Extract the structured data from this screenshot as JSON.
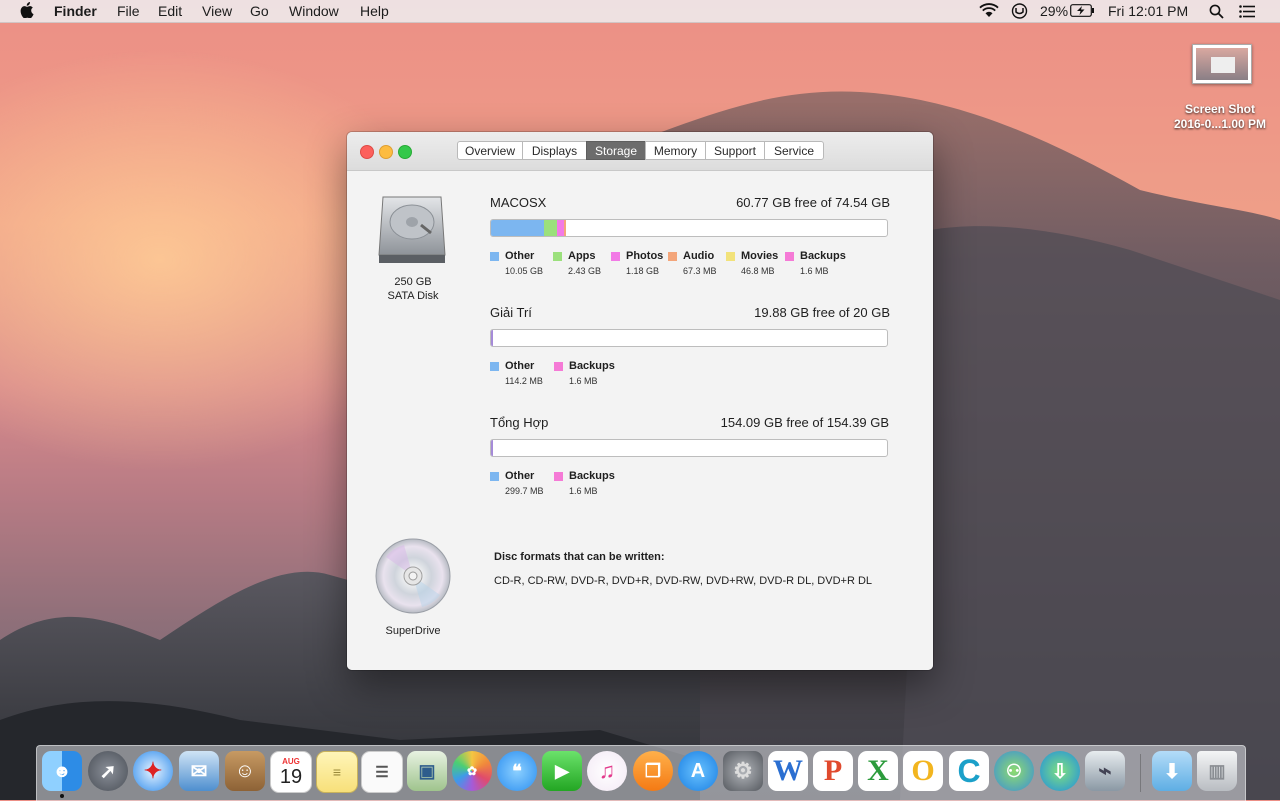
{
  "menubar": {
    "app_name": "Finder",
    "menus": [
      "File",
      "Edit",
      "View",
      "Go",
      "Window",
      "Help"
    ],
    "battery_percent": "29%",
    "clock": "Fri 12:01 PM"
  },
  "desktop": {
    "file_label_line1": "Screen Shot",
    "file_label_line2": "2016-0...1.00 PM"
  },
  "window": {
    "tabs": [
      "Overview",
      "Displays",
      "Storage",
      "Memory",
      "Support",
      "Service"
    ],
    "active_tab": "Storage",
    "disk": {
      "capacity": "250 GB",
      "type": "SATA Disk"
    },
    "volumes": [
      {
        "name": "MACOSX",
        "free_text": "60.77 GB free of 74.54 GB",
        "legend": [
          {
            "label": "Other",
            "size": "10.05 GB",
            "color": "#7cb6f0"
          },
          {
            "label": "Apps",
            "size": "2.43 GB",
            "color": "#9be07c"
          },
          {
            "label": "Photos",
            "size": "1.18 GB",
            "color": "#f27ae6"
          },
          {
            "label": "Audio",
            "size": "67.3 MB",
            "color": "#f3a57a"
          },
          {
            "label": "Movies",
            "size": "46.8 MB",
            "color": "#f2e27a"
          },
          {
            "label": "Backups",
            "size": "1.6 MB",
            "color": "#f57ad6"
          }
        ]
      },
      {
        "name": "Giải Trí",
        "free_text": "19.88 GB free of 20 GB",
        "legend": [
          {
            "label": "Other",
            "size": "114.2 MB",
            "color": "#7cb6f0"
          },
          {
            "label": "Backups",
            "size": "1.6 MB",
            "color": "#f57ad6"
          }
        ]
      },
      {
        "name": "Tổng Hợp",
        "free_text": "154.09 GB free of 154.39 GB",
        "legend": [
          {
            "label": "Other",
            "size": "299.7 MB",
            "color": "#7cb6f0"
          },
          {
            "label": "Backups",
            "size": "1.6 MB",
            "color": "#f57ad6"
          }
        ]
      }
    ],
    "superdrive": {
      "label": "SuperDrive",
      "formats_heading": "Disc formats that can be written:",
      "formats": "CD-R, CD-RW, DVD-R, DVD+R, DVD-RW, DVD+RW, DVD-R DL, DVD+R DL"
    }
  },
  "dock": {
    "calendar_month": "AUG",
    "calendar_day": "19",
    "icons": [
      "finder-icon",
      "launchpad-icon",
      "safari-icon",
      "mail-icon",
      "contacts-icon",
      "calendar-icon",
      "notes-icon",
      "reminders-icon",
      "preview-icon",
      "photos-icon",
      "messages-icon",
      "facetime-icon",
      "itunes-icon",
      "ibooks-icon",
      "app-store-icon",
      "system-preferences-icon",
      "word-icon",
      "powerpoint-icon",
      "excel-icon",
      "outlook-icon",
      "ccleaner-icon",
      "messenger-icon",
      "download-manager-icon",
      "network-utility-icon",
      "downloads-folder-icon",
      "trash-icon"
    ]
  }
}
